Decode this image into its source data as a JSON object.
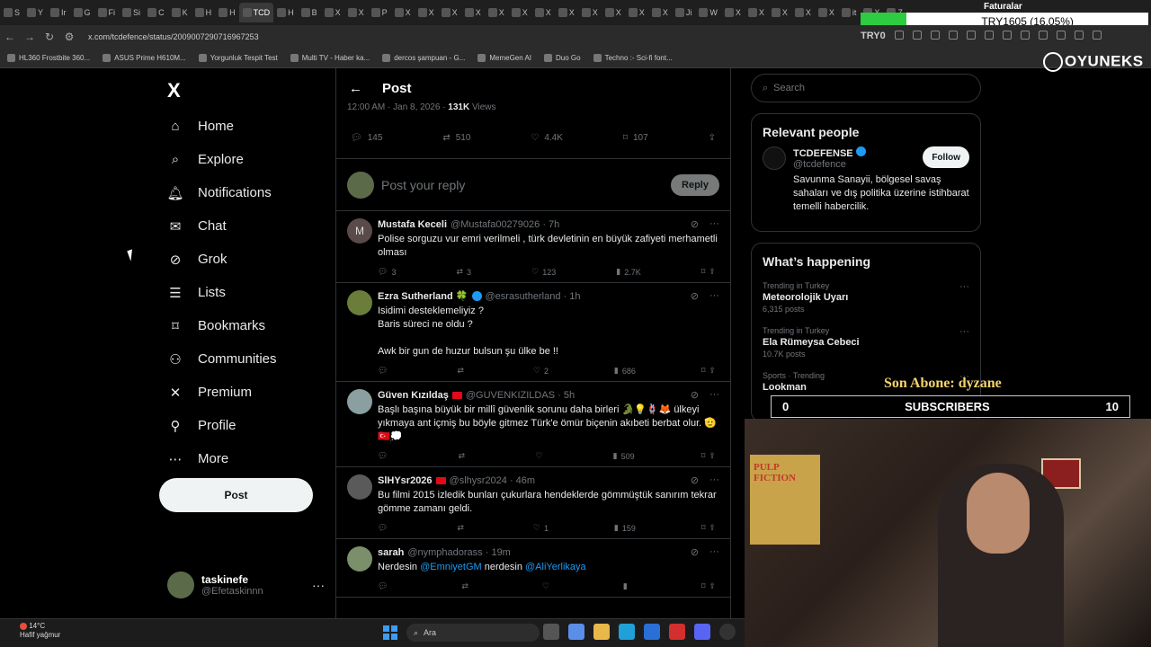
{
  "browser": {
    "tabs": [
      "S",
      "Y",
      "Ir",
      "G",
      "Fi",
      "Si",
      "C",
      "K",
      "H",
      "H",
      "TCD",
      "H",
      "B",
      "X",
      "X",
      "P",
      "X",
      "X",
      "X",
      "X",
      "X",
      "X",
      "X",
      "X",
      "X",
      "X",
      "X",
      "X",
      "Ji",
      "W",
      "X",
      "X",
      "X",
      "X",
      "X",
      "it",
      "X",
      "Z"
    ],
    "url": "x.com/tcdefence/status/2009007290716967253",
    "try_label": "TRY1605 (16.05%)",
    "try_progress": 0.1605,
    "faturalar": "Faturalar",
    "tryo": "TRY0",
    "try_right": "TRY1605",
    "bookmarks": [
      "HL360 Frostbite 360...",
      "ASUS Prime H610M...",
      "Yorgunluk Tespit Test",
      "Multi TV - Haber ka...",
      "dercos şampuan - G...",
      "MemeGen AI",
      "Duo Go",
      "Techno :- Sci-fi font..."
    ],
    "brand": "OYUNEKS"
  },
  "sidebar": {
    "logo": "X",
    "items": [
      {
        "label": "Home",
        "icon": "home-icon"
      },
      {
        "label": "Explore",
        "icon": "search-icon"
      },
      {
        "label": "Notifications",
        "icon": "bell-icon"
      },
      {
        "label": "Chat",
        "icon": "mail-icon"
      },
      {
        "label": "Grok",
        "icon": "grok-icon"
      },
      {
        "label": "Lists",
        "icon": "list-icon"
      },
      {
        "label": "Bookmarks",
        "icon": "bookmark-icon"
      },
      {
        "label": "Communities",
        "icon": "communities-icon"
      },
      {
        "label": "Premium",
        "icon": "x-icon"
      },
      {
        "label": "Profile",
        "icon": "person-icon"
      },
      {
        "label": "More",
        "icon": "more-circle-icon"
      }
    ],
    "post_label": "Post",
    "user": {
      "name": "taskinefe",
      "handle": "@Efetaskinnn"
    }
  },
  "main": {
    "title": "Post",
    "meta_time": "12:00 AM · Jan 8, 2026 · ",
    "meta_views_count": "131K",
    "meta_views_label": " Views",
    "stats": {
      "replies": "145",
      "reposts": "510",
      "likes": "4.4K",
      "bookmarks": "107"
    },
    "reply_placeholder": "Post your reply",
    "reply_button": "Reply",
    "tweets": [
      {
        "name": "Mustafa Keceli",
        "handle": "@Mustafa00279026 · 7h",
        "text": "Polise sorguzu vur emri verilmeli , türk devletinin en büyük zafiyeti merhametli olması",
        "replies": "3",
        "reposts": "3",
        "likes": "123",
        "views": "2.7K",
        "avatar_color": "#5b4a4a",
        "avatar_letter": "M"
      },
      {
        "name": "Ezra Sutherland 🍀",
        "handle": "@esrasutherland · 1h",
        "text": "Isidimi desteklemeliyiz ?\nBaris süreci ne oldu ?\n\nAwk bir gun de huzur bulsun şu ülke be !!",
        "replies": "",
        "reposts": "",
        "likes": "2",
        "views": "686",
        "avatar_color": "#6b7d3a",
        "avatar_letter": ""
      },
      {
        "name": "Güven Kızıldaş",
        "handle": "@GUVENKIZILDAS · 5h",
        "text": "Başlı başına büyük bir millî güvenlik sorunu daha birleri 🐊💡🪢🦊 ülkeyi yıkmaya ant içmiş bu böyle gitmez Türk'e ömür biçenin akıbeti berbat olur. 🫡🇹🇷💭",
        "replies": "",
        "reposts": "",
        "likes": "",
        "views": "509",
        "avatar_color": "#8aa0a0",
        "avatar_letter": ""
      },
      {
        "name": "SlHYsr2026",
        "handle": "@slhysr2024 · 46m",
        "text": "Bu filmi 2015 izledik bunları çukurlara hendeklerde gömmüştük sanırım tekrar gömme zamanı geldi.",
        "replies": "",
        "reposts": "",
        "likes": "1",
        "views": "159",
        "avatar_color": "#5a5a5a",
        "avatar_letter": ""
      },
      {
        "name": "sarah",
        "handle": "@nymphadorass · 19m",
        "text": "Nerdesin ",
        "mention1": "@EmniyetGM",
        "text2": " nerdesin ",
        "mention2": "@AliYerlikaya",
        "replies": "",
        "reposts": "",
        "likes": "",
        "views": "",
        "avatar_color": "#7a8f6a",
        "avatar_letter": ""
      }
    ]
  },
  "right": {
    "search_placeholder": "Search",
    "relevant_title": "Relevant people",
    "person": {
      "name": "TCDEFENSE",
      "handle": "@tcdefence",
      "bio": "Savunma Sanayii, bölgesel savaş sahaları ve dış politika üzerine istihbarat temelli habercilik.",
      "follow": "Follow"
    },
    "happening_title": "What’s happening",
    "trends": [
      {
        "cat": "Trending in Turkey",
        "title": "Meteorolojik Uyarı",
        "count": "6,315 posts"
      },
      {
        "cat": "Trending in Turkey",
        "title": "Ela Rümeysa Cebeci",
        "count": "10.7K posts"
      },
      {
        "cat": "Sports · Trending",
        "title": "Lookman",
        "count": ""
      }
    ]
  },
  "overlay": {
    "son_abone": "Son Abone: dyzane",
    "subs_label": "SUBSCRIBERS",
    "subs_left": "0",
    "subs_count": "10",
    "poster_text": "PULP FICTION"
  },
  "taskbar": {
    "temp": "14°C",
    "weather": "Hafif yağmur",
    "search": "Ara"
  }
}
